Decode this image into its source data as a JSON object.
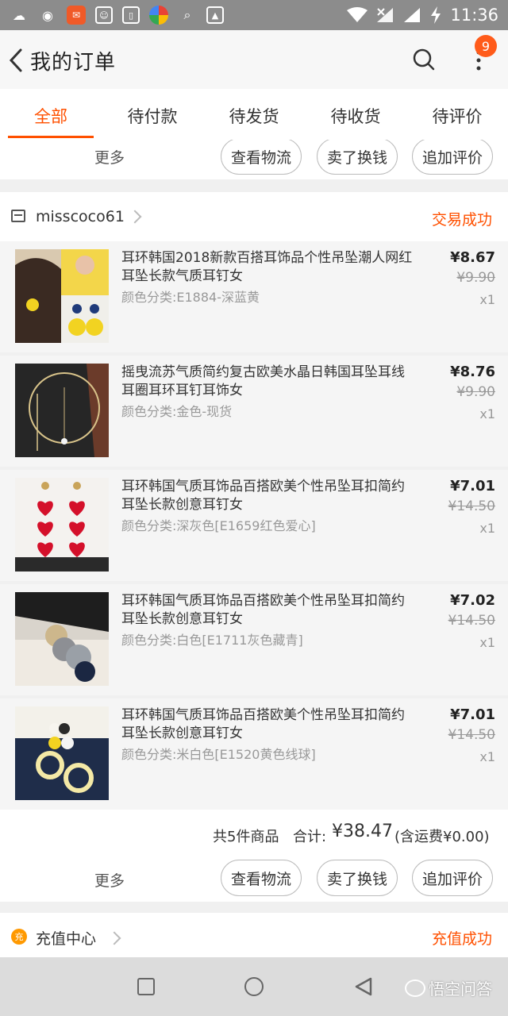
{
  "status_bar": {
    "time": "11:36"
  },
  "header": {
    "title": "我的订单",
    "badge_count": "9"
  },
  "tabs": [
    {
      "label": "全部",
      "active": true
    },
    {
      "label": "待付款",
      "active": false
    },
    {
      "label": "待发货",
      "active": false
    },
    {
      "label": "待收货",
      "active": false
    },
    {
      "label": "待评价",
      "active": false
    }
  ],
  "top_actions": {
    "more": "更多",
    "logistics": "查看物流",
    "resell": "卖了换钱",
    "review": "追加评价"
  },
  "order": {
    "shop_name": "misscoco61",
    "status": "交易成功",
    "items": [
      {
        "name": "耳环韩国2018新款百搭耳饰品个性吊坠潮人网红耳坠长款气质耳钉女",
        "sku": "颜色分类:E1884-深蓝黄",
        "price": "¥8.67",
        "original_price": "¥9.90",
        "qty": "x1"
      },
      {
        "name": "摇曳流苏气质简约复古欧美水晶日韩国耳坠耳线耳圈耳环耳钉耳饰女",
        "sku": "颜色分类:金色-现货",
        "price": "¥8.76",
        "original_price": "¥9.90",
        "qty": "x1"
      },
      {
        "name": "耳环韩国气质耳饰品百搭欧美个性吊坠耳扣简约耳坠长款创意耳钉女",
        "sku": "颜色分类:深灰色[E1659红色爱心]",
        "price": "¥7.01",
        "original_price": "¥14.50",
        "qty": "x1"
      },
      {
        "name": "耳环韩国气质耳饰品百搭欧美个性吊坠耳扣简约耳坠长款创意耳钉女",
        "sku": "颜色分类:白色[E1711灰色藏青]",
        "price": "¥7.02",
        "original_price": "¥14.50",
        "qty": "x1"
      },
      {
        "name": "耳环韩国气质耳饰品百搭欧美个性吊坠耳扣简约耳坠长款创意耳钉女",
        "sku": "颜色分类:米白色[E1520黄色线球]",
        "price": "¥7.01",
        "original_price": "¥14.50",
        "qty": "x1"
      }
    ],
    "summary": {
      "count_text": "共5件商品",
      "total_label": "合计:",
      "total": "¥38.47",
      "shipping": "(含运费¥0.00)"
    },
    "actions": {
      "more": "更多",
      "logistics": "查看物流",
      "resell": "卖了换钱",
      "review": "追加评价"
    }
  },
  "next_order": {
    "shop_name": "充值中心",
    "status": "充值成功"
  },
  "watermark": "悟空问答",
  "colors": {
    "accent": "#ff5000",
    "badge": "#ff5b1a",
    "status_bar": "#8c8c8c"
  }
}
